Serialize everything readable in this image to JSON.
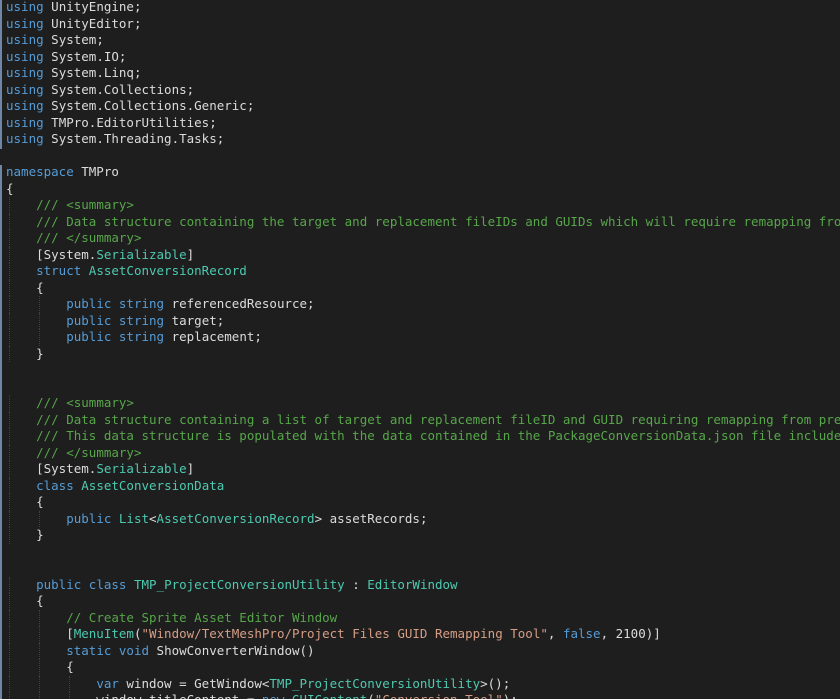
{
  "editor": {
    "language": "C#",
    "colors": {
      "background": "#1e1e1e",
      "keyword": "#569cd6",
      "type": "#4ec9b0",
      "comment": "#57a64a",
      "string": "#d69d85",
      "identifier": "#dcdcdc"
    }
  },
  "code": {
    "lines": [
      [
        {
          "k": "kw",
          "t": "using"
        },
        {
          "k": "id",
          "t": " UnityEngine;"
        }
      ],
      [
        {
          "k": "kw",
          "t": "using"
        },
        {
          "k": "id",
          "t": " UnityEditor;"
        }
      ],
      [
        {
          "k": "kw",
          "t": "using"
        },
        {
          "k": "id",
          "t": " System;"
        }
      ],
      [
        {
          "k": "kw",
          "t": "using"
        },
        {
          "k": "id",
          "t": " System.IO;"
        }
      ],
      [
        {
          "k": "kw",
          "t": "using"
        },
        {
          "k": "id",
          "t": " System.Linq;"
        }
      ],
      [
        {
          "k": "kw",
          "t": "using"
        },
        {
          "k": "id",
          "t": " System.Collections;"
        }
      ],
      [
        {
          "k": "kw",
          "t": "using"
        },
        {
          "k": "id",
          "t": " System.Collections.Generic;"
        }
      ],
      [
        {
          "k": "kw",
          "t": "using"
        },
        {
          "k": "id",
          "t": " TMPro.EditorUtilities;"
        }
      ],
      [
        {
          "k": "kw",
          "t": "using"
        },
        {
          "k": "id",
          "t": " System.Threading.Tasks;"
        }
      ],
      [],
      [
        {
          "k": "kw",
          "t": "namespace"
        },
        {
          "k": "id",
          "t": " TMPro"
        }
      ],
      [
        {
          "k": "id",
          "t": "{"
        }
      ],
      [
        {
          "k": "id",
          "t": "    "
        },
        {
          "k": "cm",
          "t": "/// <summary>"
        }
      ],
      [
        {
          "k": "id",
          "t": "    "
        },
        {
          "k": "cm",
          "t": "/// Data structure containing the target and replacement fileIDs and GUIDs which will require remapping from previous"
        }
      ],
      [
        {
          "k": "id",
          "t": "    "
        },
        {
          "k": "cm",
          "t": "/// </summary>"
        }
      ],
      [
        {
          "k": "id",
          "t": "    [System."
        },
        {
          "k": "attr",
          "t": "Serializable"
        },
        {
          "k": "id",
          "t": "]"
        }
      ],
      [
        {
          "k": "id",
          "t": "    "
        },
        {
          "k": "kw",
          "t": "struct"
        },
        {
          "k": "id",
          "t": " "
        },
        {
          "k": "type",
          "t": "AssetConversionRecord"
        }
      ],
      [
        {
          "k": "id",
          "t": "    {"
        }
      ],
      [
        {
          "k": "id",
          "t": "        "
        },
        {
          "k": "kw",
          "t": "public"
        },
        {
          "k": "id",
          "t": " "
        },
        {
          "k": "kw",
          "t": "string"
        },
        {
          "k": "id",
          "t": " referencedResource;"
        }
      ],
      [
        {
          "k": "id",
          "t": "        "
        },
        {
          "k": "kw",
          "t": "public"
        },
        {
          "k": "id",
          "t": " "
        },
        {
          "k": "kw",
          "t": "string"
        },
        {
          "k": "id",
          "t": " target;"
        }
      ],
      [
        {
          "k": "id",
          "t": "        "
        },
        {
          "k": "kw",
          "t": "public"
        },
        {
          "k": "id",
          "t": " "
        },
        {
          "k": "kw",
          "t": "string"
        },
        {
          "k": "id",
          "t": " replacement;"
        }
      ],
      [
        {
          "k": "id",
          "t": "    }"
        }
      ],
      [],
      [],
      [
        {
          "k": "id",
          "t": "    "
        },
        {
          "k": "cm",
          "t": "/// <summary>"
        }
      ],
      [
        {
          "k": "id",
          "t": "    "
        },
        {
          "k": "cm",
          "t": "/// Data structure containing a list of target and replacement fileID and GUID requiring remapping from previous vers"
        }
      ],
      [
        {
          "k": "id",
          "t": "    "
        },
        {
          "k": "cm",
          "t": "/// This data structure is populated with the data contained in the PackageConversionData.json file included in the p"
        }
      ],
      [
        {
          "k": "id",
          "t": "    "
        },
        {
          "k": "cm",
          "t": "/// </summary>"
        }
      ],
      [
        {
          "k": "id",
          "t": "    [System."
        },
        {
          "k": "attr",
          "t": "Serializable"
        },
        {
          "k": "id",
          "t": "]"
        }
      ],
      [
        {
          "k": "id",
          "t": "    "
        },
        {
          "k": "kw",
          "t": "class"
        },
        {
          "k": "id",
          "t": " "
        },
        {
          "k": "type",
          "t": "AssetConversionData"
        }
      ],
      [
        {
          "k": "id",
          "t": "    {"
        }
      ],
      [
        {
          "k": "id",
          "t": "        "
        },
        {
          "k": "kw",
          "t": "public"
        },
        {
          "k": "id",
          "t": " "
        },
        {
          "k": "type",
          "t": "List"
        },
        {
          "k": "id",
          "t": "<"
        },
        {
          "k": "type",
          "t": "AssetConversionRecord"
        },
        {
          "k": "id",
          "t": "> assetRecords;"
        }
      ],
      [
        {
          "k": "id",
          "t": "    }"
        }
      ],
      [],
      [],
      [
        {
          "k": "id",
          "t": "    "
        },
        {
          "k": "kw",
          "t": "public"
        },
        {
          "k": "id",
          "t": " "
        },
        {
          "k": "kw",
          "t": "class"
        },
        {
          "k": "id",
          "t": " "
        },
        {
          "k": "type",
          "t": "TMP_ProjectConversionUtility"
        },
        {
          "k": "id",
          "t": " : "
        },
        {
          "k": "type",
          "t": "EditorWindow"
        }
      ],
      [
        {
          "k": "id",
          "t": "    {"
        }
      ],
      [
        {
          "k": "id",
          "t": "        "
        },
        {
          "k": "cm",
          "t": "// Create Sprite Asset Editor Window"
        }
      ],
      [
        {
          "k": "id",
          "t": "        ["
        },
        {
          "k": "type",
          "t": "MenuItem"
        },
        {
          "k": "id",
          "t": "("
        },
        {
          "k": "str",
          "t": "\"Window/TextMeshPro/Project Files GUID Remapping Tool\""
        },
        {
          "k": "id",
          "t": ", "
        },
        {
          "k": "kw",
          "t": "false"
        },
        {
          "k": "id",
          "t": ", 2100)]"
        }
      ],
      [
        {
          "k": "id",
          "t": "        "
        },
        {
          "k": "kw",
          "t": "static"
        },
        {
          "k": "id",
          "t": " "
        },
        {
          "k": "kw",
          "t": "void"
        },
        {
          "k": "id",
          "t": " ShowConverterWindow()"
        }
      ],
      [
        {
          "k": "id",
          "t": "        {"
        }
      ],
      [
        {
          "k": "id",
          "t": "            "
        },
        {
          "k": "kw",
          "t": "var"
        },
        {
          "k": "id",
          "t": " window = GetWindow<"
        },
        {
          "k": "type",
          "t": "TMP_ProjectConversionUtility"
        },
        {
          "k": "id",
          "t": ">();"
        }
      ],
      [
        {
          "k": "id",
          "t": "            window.titleContent = "
        },
        {
          "k": "kw",
          "t": "new"
        },
        {
          "k": "id",
          "t": " "
        },
        {
          "k": "type",
          "t": "GUIContent"
        },
        {
          "k": "id",
          "t": "("
        },
        {
          "k": "str",
          "t": "\"Conversion Tool\""
        },
        {
          "k": "id",
          "t": ");"
        }
      ]
    ]
  }
}
